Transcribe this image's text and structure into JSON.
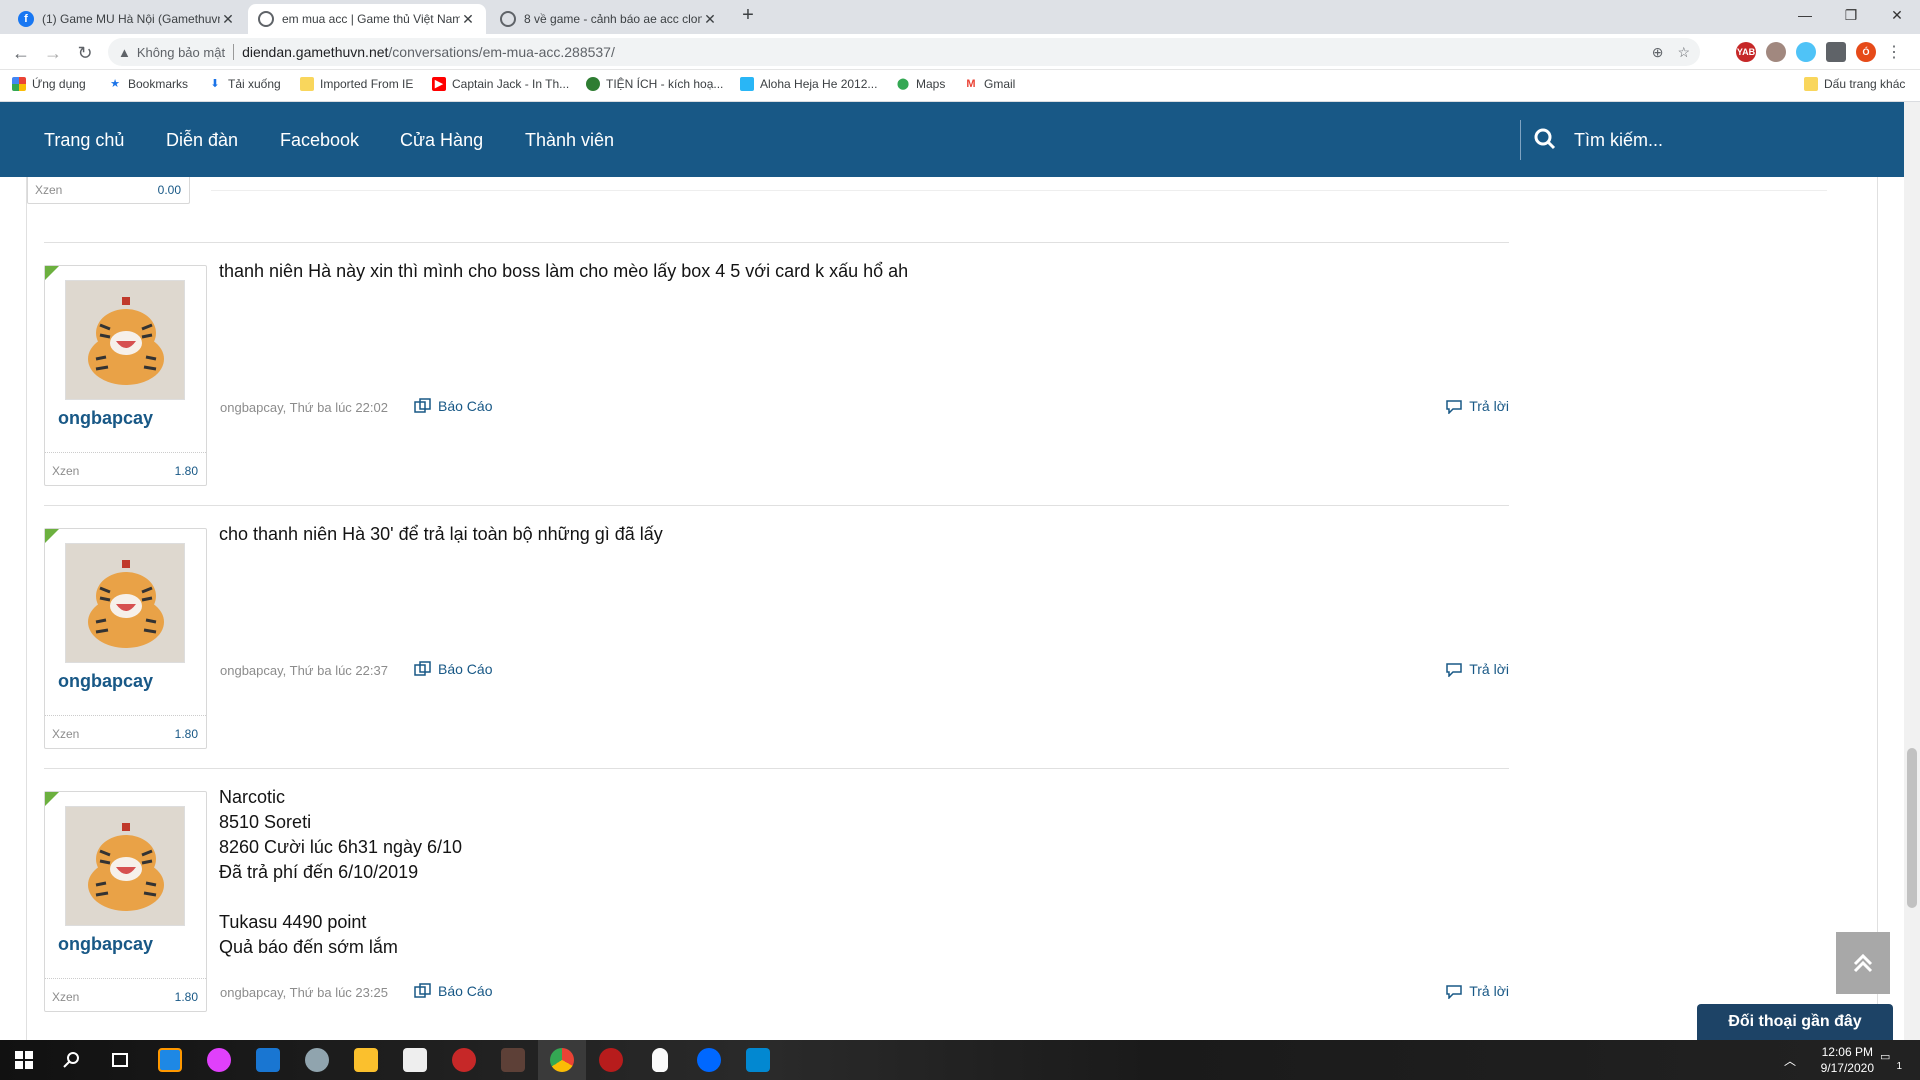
{
  "browser": {
    "tabs": [
      {
        "title": "(1) Game MU Hà Nội (Gamethuvn",
        "favicon": "facebook-icon"
      },
      {
        "title": "em mua acc | Game thủ Việt Nam",
        "favicon": "globe-icon"
      },
      {
        "title": "8 về game - cảnh báo ae acc clon",
        "favicon": "globe-icon"
      }
    ],
    "security_label": "Không bảo mật",
    "url_host": "diendan.gamethuvn.net",
    "url_path": "/conversations/em-mua-acc.288537/",
    "bookmarks": [
      {
        "label": "Ứng dụng",
        "icon": "apps-icon"
      },
      {
        "label": "Bookmarks",
        "icon": "star-icon"
      },
      {
        "label": "Tải xuống",
        "icon": "download-icon"
      },
      {
        "label": "Imported From IE",
        "icon": "folder-icon"
      },
      {
        "label": "Captain Jack - In Th...",
        "icon": "youtube-icon"
      },
      {
        "label": "TIỆN ÍCH - kích hoạ...",
        "icon": "leaf-icon"
      },
      {
        "label": "Aloha Heja He 2012...",
        "icon": "camera-icon"
      },
      {
        "label": "Maps",
        "icon": "maps-icon"
      },
      {
        "label": "Gmail",
        "icon": "gmail-icon"
      }
    ],
    "other_bookmarks": "Dấu trang khác"
  },
  "site": {
    "nav": [
      "Trang chủ",
      "Diễn đàn",
      "Facebook",
      "Cửa Hàng",
      "Thành viên"
    ],
    "search_label": "Tìm kiếm...",
    "partial_stat": {
      "key": "Xzen",
      "value": "0.00"
    },
    "messages": [
      {
        "user": "ongbapcay",
        "stat_key": "Xzen",
        "stat_value": "1.80",
        "lines": [
          "thanh niên Hà này xin thì mình cho boss làm cho mèo lấy box 4 5 với card k xấu hổ ah"
        ],
        "meta": "ongbapcay, Thứ ba lúc 22:02",
        "report": "Báo Cáo",
        "reply": "Trả lời"
      },
      {
        "user": "ongbapcay",
        "stat_key": "Xzen",
        "stat_value": "1.80",
        "lines": [
          "cho thanh niên Hà 30' để trả lại toàn bộ những gì đã lấy"
        ],
        "meta": "ongbapcay, Thứ ba lúc 22:37",
        "report": "Báo Cáo",
        "reply": "Trả lời"
      },
      {
        "user": "ongbapcay",
        "stat_key": "Xzen",
        "stat_value": "1.80",
        "lines": [
          "Narcotic",
          "8510 Soreti",
          "8260 Cười lúc 6h31 ngày 6/10",
          "Đã trả phí đến 6/10/2019",
          "",
          "Tukasu 4490 point",
          "Quả báo đến sớm lắm"
        ],
        "meta": "ongbapcay, Thứ ba lúc 23:25",
        "report": "Báo Cáo",
        "reply": "Trả lời"
      }
    ],
    "chat_bar": "Đối thoại gần đây"
  },
  "taskbar": {
    "time": "12:06 PM",
    "date": "9/17/2020",
    "notification_count": "1"
  },
  "colors": {
    "nav_bg": "#185886",
    "accent_green": "#6cb03f",
    "chat_bar": "#1d4366"
  }
}
